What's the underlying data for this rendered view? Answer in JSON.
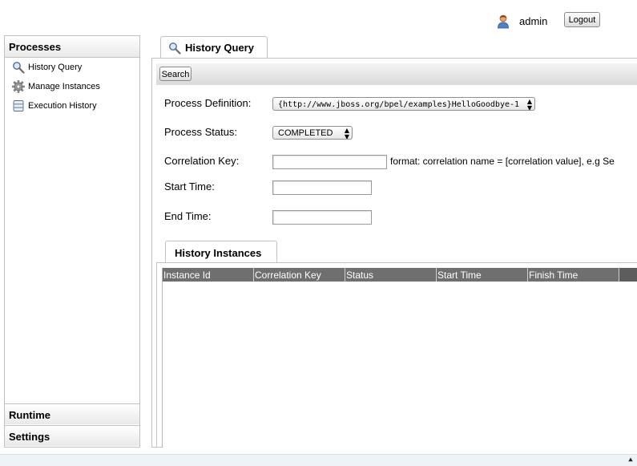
{
  "header": {
    "user_icon": "user-icon",
    "username": "admin",
    "logout_label": "Logout"
  },
  "sidebar": {
    "title": "Processes",
    "items": [
      {
        "label": "History Query",
        "icon": "magnifier-icon"
      },
      {
        "label": "Manage Instances",
        "icon": "gear-icon"
      },
      {
        "label": "Execution History",
        "icon": "database-icon"
      }
    ],
    "sections": [
      {
        "label": "Runtime"
      },
      {
        "label": "Settings"
      }
    ]
  },
  "main": {
    "tab_label": "History Query",
    "tab_icon": "magnifier-icon",
    "search_label": "Search",
    "form": {
      "process_definition_label": "Process Definition:",
      "process_definition_value": "{http://www.jboss.org/bpel/examples}HelloGoodbye-1",
      "process_status_label": "Process Status:",
      "process_status_value": "COMPLETED",
      "correlation_key_label": "Correlation Key:",
      "correlation_key_value": "",
      "correlation_hint": "format: correlation name = [correlation value], e.g Se",
      "start_time_label": "Start Time:",
      "start_time_value": "",
      "end_time_label": "End Time:",
      "end_time_value": ""
    },
    "results": {
      "tab_label": "History Instances",
      "columns": [
        "Instance Id",
        "Correlation Key",
        "Status",
        "Start Time",
        "Finish Time"
      ],
      "rows": []
    }
  },
  "colors": {
    "table_header_bg": "#6f6f6f",
    "footer_bg": "#eef3f6",
    "border": "#c2c2c2"
  }
}
